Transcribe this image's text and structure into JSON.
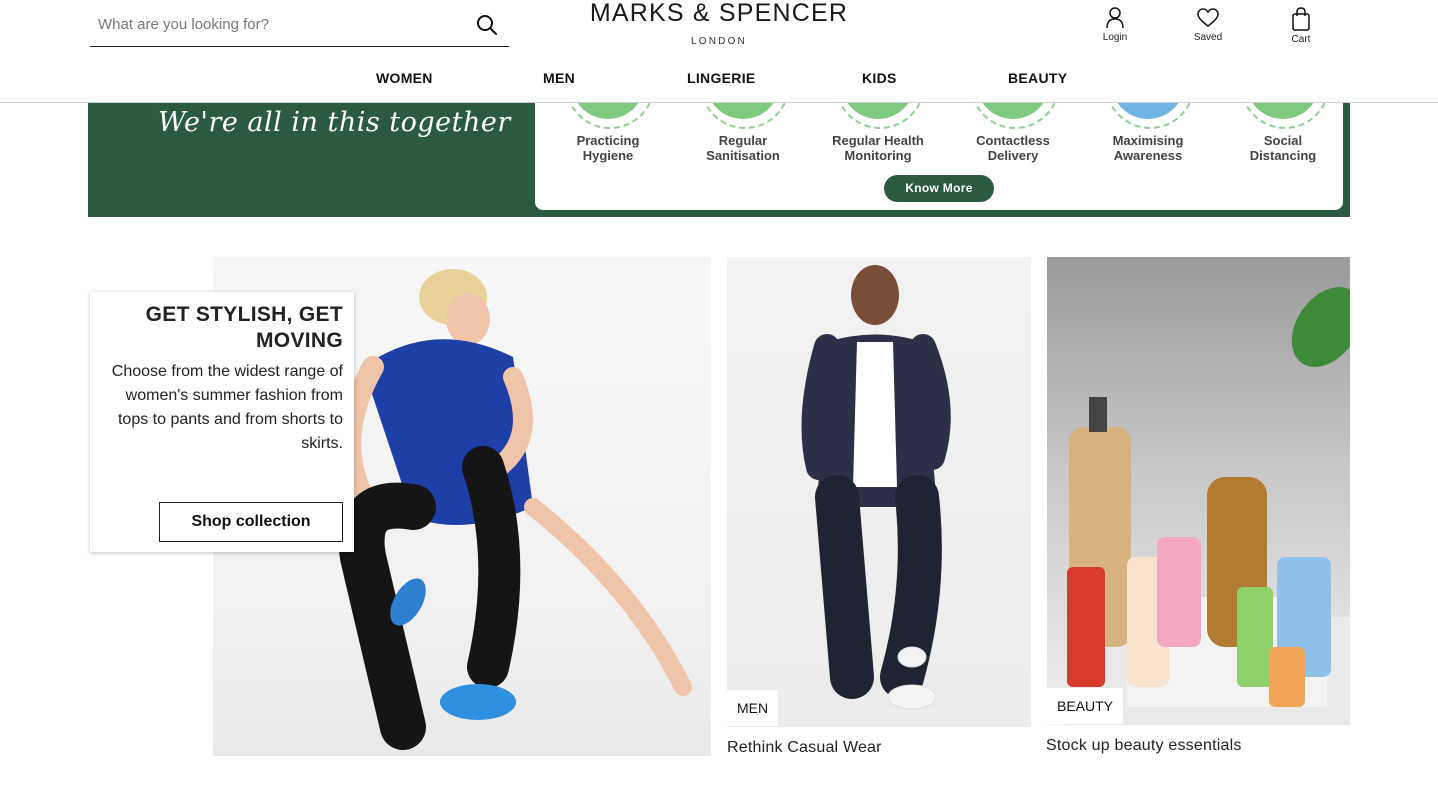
{
  "search": {
    "placeholder": "What are you looking for?"
  },
  "logo": {
    "brand": "MARKS & SPENCER",
    "sub": "LONDON"
  },
  "account": {
    "login": "Login",
    "saved": "Saved",
    "cart": "Cart"
  },
  "nav": [
    "WOMEN",
    "MEN",
    "LINGERIE",
    "KIDS",
    "BEAUTY"
  ],
  "banner": {
    "slogan": "We're all in this together",
    "measures": [
      [
        "Practicing",
        "Hygiene"
      ],
      [
        "Regular",
        "Sanitisation"
      ],
      [
        "Regular Health",
        "Monitoring"
      ],
      [
        "Contactless",
        "Delivery"
      ],
      [
        "Maximising",
        "Awareness"
      ],
      [
        "Social",
        "Distancing"
      ]
    ],
    "button": "Know More"
  },
  "promo": {
    "title": "GET STYLISH, GET MOVING",
    "description": "Choose from the widest range of women's summer fashion from tops to pants and from shorts to skirts.",
    "button": "Shop collection"
  },
  "cards": [
    {
      "tag": "MEN",
      "caption": "Rethink Casual Wear"
    },
    {
      "tag": "BEAUTY",
      "caption": "Stock up beauty essentials"
    }
  ],
  "colors": {
    "banner_green": "#2a5b3e",
    "measure_green": "#7fca7f",
    "text": "#111111"
  },
  "icons": [
    "search-icon",
    "user-icon",
    "heart-icon",
    "bag-icon"
  ]
}
